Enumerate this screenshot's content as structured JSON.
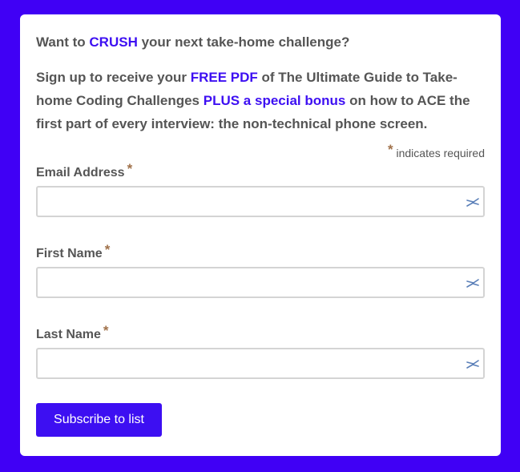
{
  "headline": {
    "before": "Want to ",
    "accent": "CRUSH",
    "after": " your next take-home challenge?"
  },
  "intro": {
    "part1": "Sign up to receive your ",
    "accent1": "FREE PDF",
    "part2": " of The Ultimate Guide to Take-home Coding Challenges ",
    "accent2": "PLUS a special bonus",
    "part3": " on how to ACE the first part of every interview: the non-technical phone screen."
  },
  "required_note": {
    "asterisk": "*",
    "text": " indicates required"
  },
  "fields": [
    {
      "label": "Email Address",
      "asterisk": "*",
      "value": "",
      "placeholder": ""
    },
    {
      "label": "First Name",
      "asterisk": "*",
      "value": "",
      "placeholder": ""
    },
    {
      "label": "Last Name",
      "asterisk": "*",
      "value": "",
      "placeholder": ""
    }
  ],
  "submit": {
    "label": "Subscribe to list"
  },
  "colors": {
    "background": "#4000f5",
    "accent": "#3d0ff2",
    "asterisk": "#a0714a",
    "text": "#555555"
  },
  "icons": {
    "autofill": "autofill-key-icon"
  }
}
